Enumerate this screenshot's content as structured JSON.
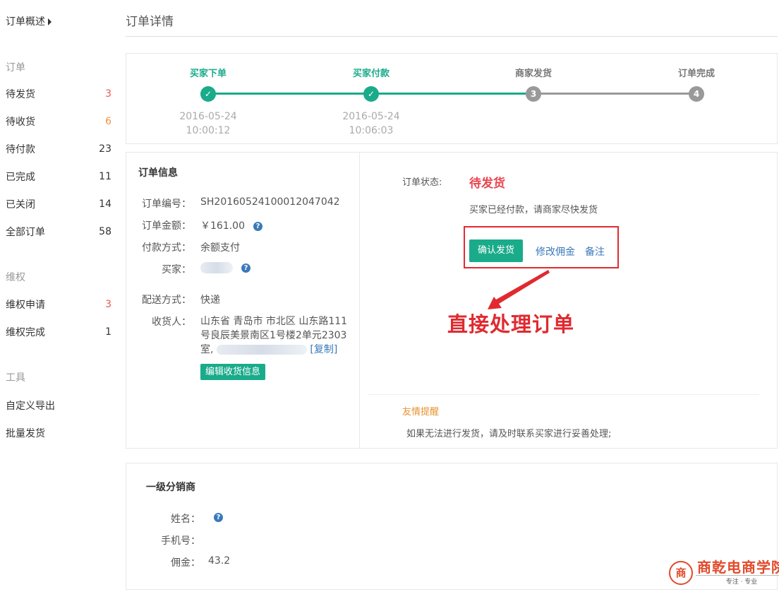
{
  "sidebar": {
    "overview": "订单概述",
    "sections": [
      {
        "heading": "订单",
        "items": [
          {
            "label": "待发货",
            "count": "3"
          },
          {
            "label": "待收货",
            "count": "6"
          },
          {
            "label": "待付款",
            "count": "23"
          },
          {
            "label": "已完成",
            "count": "11"
          },
          {
            "label": "已关闭",
            "count": "14"
          },
          {
            "label": "全部订单",
            "count": "58"
          }
        ]
      },
      {
        "heading": "维权",
        "items": [
          {
            "label": "维权申请",
            "count": "3"
          },
          {
            "label": "维权完成",
            "count": "1"
          }
        ]
      },
      {
        "heading": "工具",
        "items": [
          {
            "label": "自定义导出"
          },
          {
            "label": "批量发货"
          }
        ]
      }
    ]
  },
  "page": {
    "title": "订单详情"
  },
  "progress": {
    "steps": [
      {
        "label": "买家下单",
        "state": "done",
        "mark": "✓",
        "date": "2016-05-24",
        "time": "10:00:12"
      },
      {
        "label": "买家付款",
        "state": "done",
        "mark": "✓",
        "date": "2016-05-24",
        "time": "10:06:03"
      },
      {
        "label": "商家发货",
        "state": "todo",
        "mark": "3"
      },
      {
        "label": "订单完成",
        "state": "todo",
        "mark": "4"
      }
    ],
    "colors": {
      "done": "#1aab8a",
      "todo": "#999999"
    }
  },
  "order_info": {
    "title": "订单信息",
    "order_no_label": "订单编号：",
    "order_no": "SH20160524100012047042",
    "amount_label": "订单金额：",
    "amount": "￥161.00",
    "pay_label": "付款方式：",
    "pay_method": "余额支付",
    "buyer_label": "买家：",
    "ship_label": "配送方式：",
    "ship_method": "快递",
    "receiver_label": "收货人：",
    "address_line1": "山东省 青岛市 市北区 山东路111",
    "address_line2": "号良辰美景南区1号楼2单元2303",
    "address_line3": "室,",
    "copy_label": "[复制]",
    "edit_button": "编辑收货信息",
    "help_mark": "?"
  },
  "status_panel": {
    "status_label": "订单状态:",
    "status_value": "待发货",
    "status_desc": "买家已经付款，请商家尽快发货",
    "ship_button": "确认发货",
    "commission_link": "修改佣金",
    "note_link": "备注",
    "annotation": "直接处理订单",
    "tip_title": "友情提醒",
    "tip_text": "如果无法进行发货，请及时联系买家进行妥善处理;"
  },
  "distributor": {
    "title": "一级分销商",
    "name_label": "姓名：",
    "phone_label": "手机号：",
    "commission_label": "佣金：",
    "commission": "43.2"
  },
  "watermark": {
    "logo_char": "商",
    "name": "商乾电商学院",
    "sub": "专注 · 专业"
  }
}
